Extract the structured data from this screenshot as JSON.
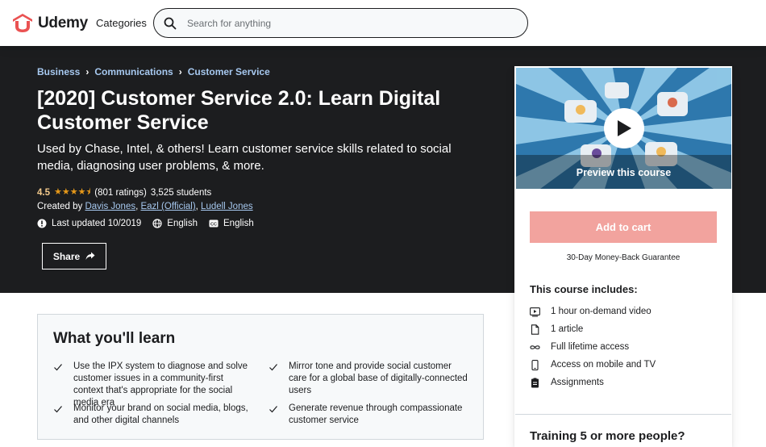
{
  "header": {
    "brand": "Udemy",
    "categories_label": "Categories",
    "search_placeholder": "Search for anything"
  },
  "course": {
    "breadcrumb": [
      "Business",
      "Communications",
      "Customer Service"
    ],
    "title": "[2020] Customer Service 2.0: Learn Digital Customer Service",
    "subtitle": "Used by Chase, Intel, & others! Learn customer service skills related to social media, diagnosing user problems, & more.",
    "rating": "4.5",
    "rating_value": 4.5,
    "ratings_count": "(801 ratings)",
    "students": "3,525 students",
    "created_by_label": "Created by",
    "authors": [
      "Davis Jones",
      "Eazl (Official)",
      "Ludell Jones"
    ],
    "last_updated": "Last updated 10/2019",
    "language": "English",
    "captions": "English",
    "share_label": "Share"
  },
  "sidebar": {
    "preview_label": "Preview this course",
    "add_to_cart": "Add to cart",
    "guarantee": "30-Day Money-Back Guarantee",
    "includes_title": "This course includes:",
    "includes": [
      {
        "icon": "video-icon",
        "label": "1 hour on-demand video"
      },
      {
        "icon": "file-icon",
        "label": "1 article"
      },
      {
        "icon": "infinity-icon",
        "label": "Full lifetime access"
      },
      {
        "icon": "mobile-icon",
        "label": "Access on mobile and TV"
      },
      {
        "icon": "assignment-icon",
        "label": "Assignments"
      }
    ],
    "training_title": "Training 5 or more people?"
  },
  "learn": {
    "title": "What you'll learn",
    "items": [
      "Use the IPX system to diagnose and solve customer issues in a community-first context that's appropriate for the social media era",
      "Mirror tone and provide social customer care for a global base of digitally-connected users",
      "Monitor your brand on social media, blogs, and other digital channels",
      "Generate revenue through compassionate customer service"
    ]
  },
  "colors": {
    "brand_red": "#a435f0",
    "hero_bg": "#1c1d1f",
    "add_to_cart_bg": "#f2a39e",
    "star": "#e59819"
  }
}
